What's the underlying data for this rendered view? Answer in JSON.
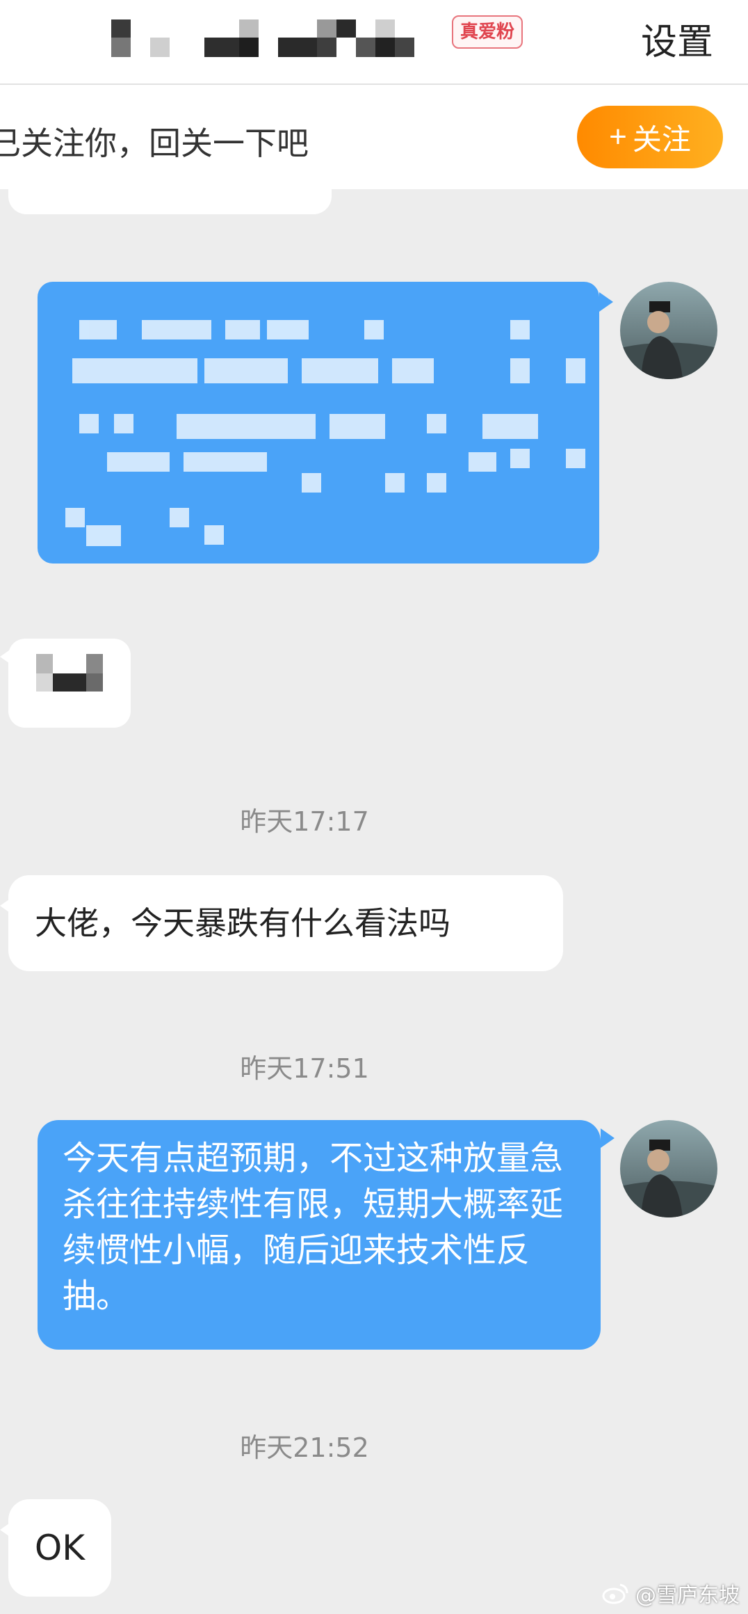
{
  "header": {
    "fan_badge": "真爱粉",
    "settings_label": "设置"
  },
  "follow_banner": {
    "text": "已关注你，回关一下吧",
    "button_label": "关注",
    "button_icon": "plus-icon"
  },
  "messages": [
    {
      "type": "timestamp",
      "text": "昨天17:17"
    },
    {
      "type": "received",
      "text": "大佬，今天暴跌有什么看法吗"
    },
    {
      "type": "timestamp",
      "text": "昨天17:51"
    },
    {
      "type": "sent",
      "text": "今天有点超预期，不过这种放量急杀往往持续性有限，短期大概率延续惯性小幅，随后迎来技术性反抽。"
    },
    {
      "type": "timestamp",
      "text": "昨天21:52"
    },
    {
      "type": "received",
      "text": "OK"
    }
  ],
  "watermark": {
    "icon": "weibo-icon",
    "text": "@雪庐东坡"
  },
  "colors": {
    "sent_bubble": "#4aa3f8",
    "follow_button": "#ff9a10",
    "background": "#ededed"
  }
}
